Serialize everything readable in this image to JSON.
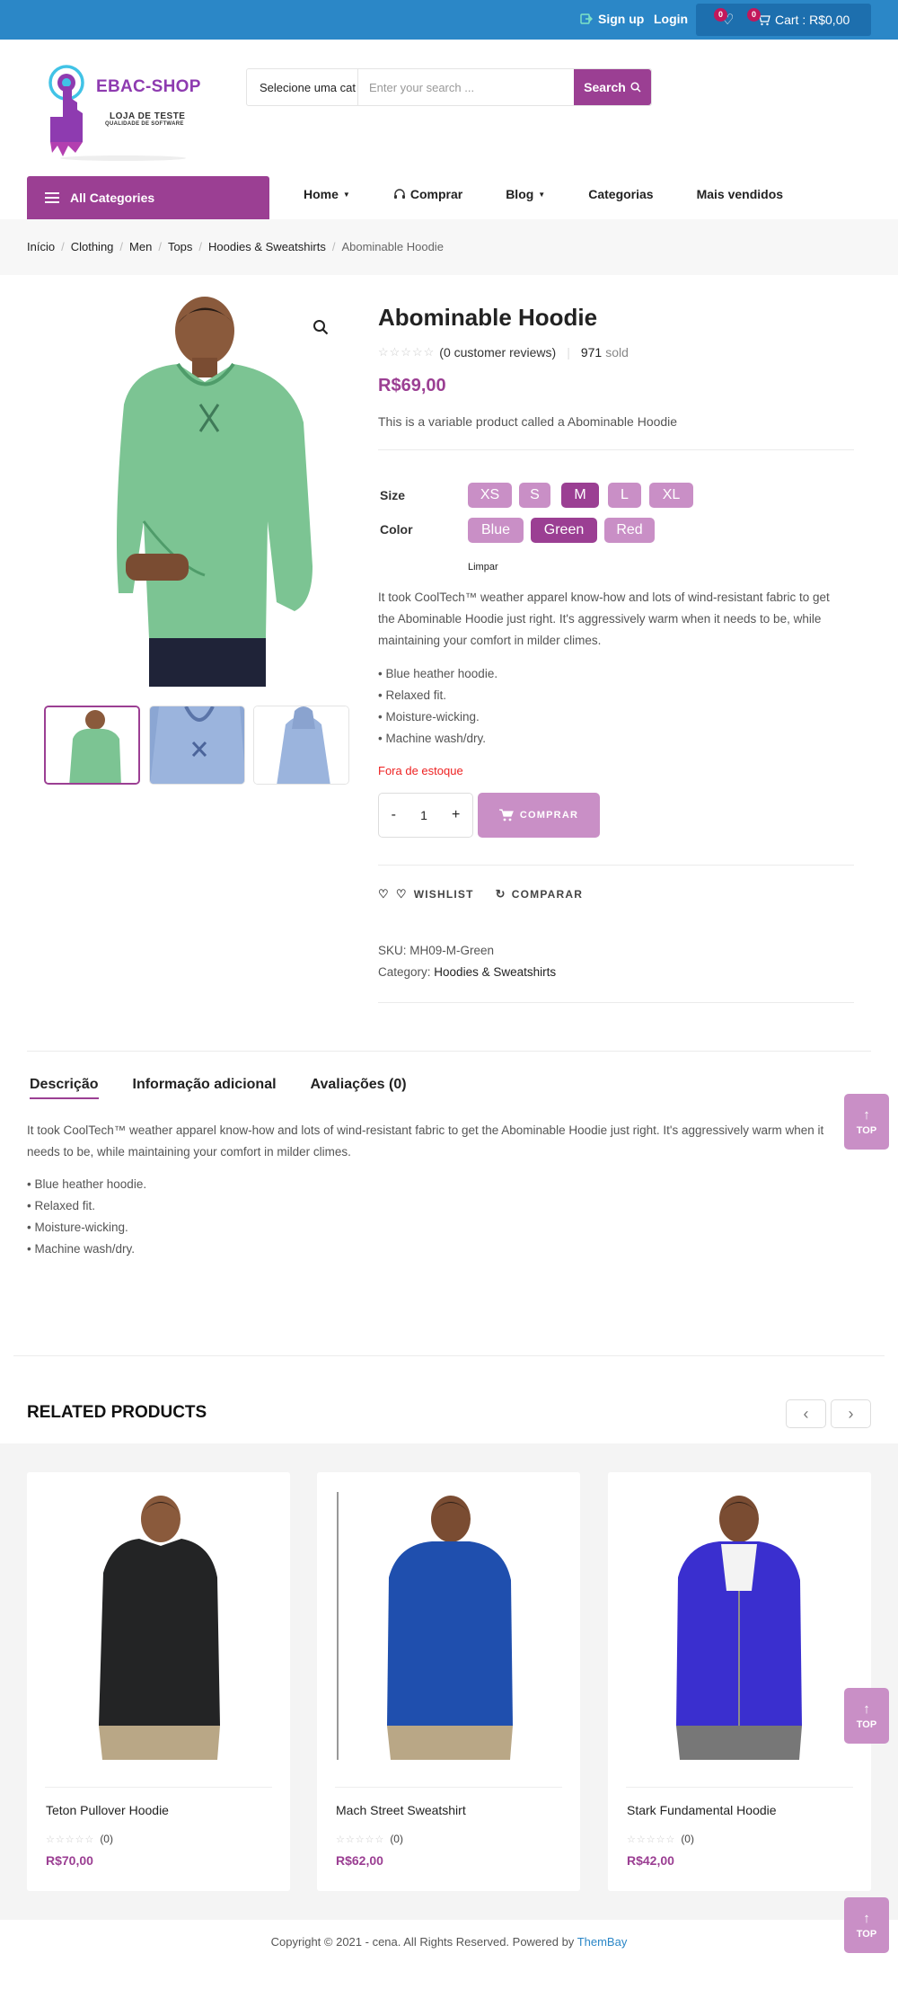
{
  "topbar": {
    "signup": "Sign up",
    "login": "Login",
    "wishlist_count": "0",
    "cart_count": "0",
    "cart_label": "Cart : R$0,00"
  },
  "logo": {
    "title": "EBAC-SHOP",
    "subtitle": "LOJA DE TESTE",
    "tagline": "QUALIDADE DE SOFTWARE"
  },
  "search": {
    "category": "Selecione uma cat",
    "placeholder": "Enter your search ...",
    "button": "Search"
  },
  "nav": {
    "all_categories": "All Categories",
    "items": [
      "Home",
      "Comprar",
      "Blog",
      "Categorias",
      "Mais vendidos"
    ]
  },
  "breadcrumb": [
    "Início",
    "Clothing",
    "Men",
    "Tops",
    "Hoodies & Sweatshirts",
    "Abominable Hoodie"
  ],
  "product": {
    "title": "Abominable Hoodie",
    "reviews": "(0 customer reviews)",
    "sold_count": "971",
    "sold_label": "sold",
    "price": "R$69,00",
    "short_description": "This is a variable product called a Abominable Hoodie",
    "size_label": "Size",
    "sizes": [
      "XS",
      "S",
      "M",
      "L",
      "XL"
    ],
    "selected_size": "M",
    "color_label": "Color",
    "colors": [
      "Blue",
      "Green",
      "Red"
    ],
    "selected_color": "Green",
    "clear_label": "Limpar",
    "long_description": "It took CoolTech™ weather apparel know-how and lots of wind-resistant fabric to get the Abominable Hoodie just right. It's aggressively warm when it needs to be, while maintaining your comfort in milder climes.",
    "features": [
      "• Blue heather hoodie.",
      "• Relaxed fit.",
      "• Moisture-wicking.",
      "• Machine wash/dry."
    ],
    "stock_status": "Fora de estoque",
    "qty_minus": "-",
    "qty_value": "1",
    "qty_plus": "+",
    "buy_button": "COMPRAR",
    "wishlist": "WISHLIST",
    "compare": "COMPARAR",
    "sku_label": "SKU:",
    "sku": "MH09-M-Green",
    "category_label": "Category:",
    "category": "Hoodies & Sweatshirts"
  },
  "tabs": {
    "items": [
      "Descrição",
      "Informação adicional",
      "Avaliações (0)"
    ],
    "description": "It took CoolTech™ weather apparel know-how and lots of wind-resistant fabric to get the Abominable Hoodie just right. It's aggressively warm when it needs to be, while maintaining your comfort in milder climes.",
    "features": [
      "• Blue heather hoodie.",
      "• Relaxed fit.",
      "• Moisture-wicking.",
      "• Machine wash/dry."
    ]
  },
  "related": {
    "title": "RELATED PRODUCTS",
    "products": [
      {
        "name": "Teton Pullover Hoodie",
        "count": "(0)",
        "price": "R$70,00"
      },
      {
        "name": "Mach Street Sweatshirt",
        "count": "(0)",
        "price": "R$62,00"
      },
      {
        "name": "Stark Fundamental Hoodie",
        "count": "(0)",
        "price": "R$42,00"
      }
    ]
  },
  "top_label": "TOP",
  "footer": {
    "text": "Copyright © 2021 - cena. All Rights Reserved. Powered by",
    "link": "ThemBay"
  },
  "colors": {
    "brand_purple": "#9b3f93",
    "light_purple": "#c98fc6",
    "topbar_blue": "#2b87c7",
    "stock_red": "#ee2222"
  },
  "icons": [
    "user-plus-icon",
    "heart-icon",
    "cart-icon",
    "search-icon",
    "menu-icon",
    "headset-icon",
    "chevron-down-icon",
    "zoom-icon",
    "star-icon",
    "refresh-icon",
    "chevron-left-icon",
    "chevron-right-icon",
    "arrow-up-icon"
  ]
}
